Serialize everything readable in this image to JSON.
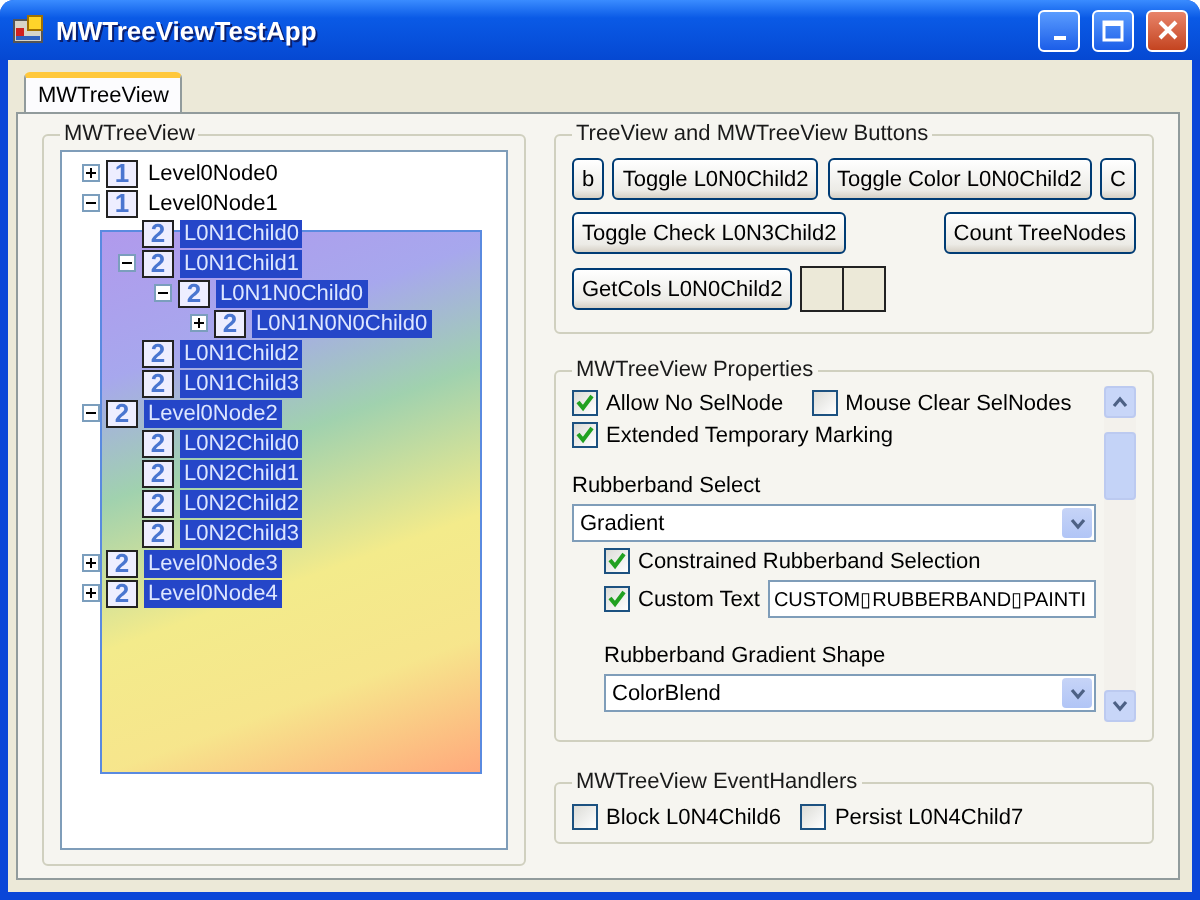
{
  "window": {
    "title": "MWTreeViewTestApp"
  },
  "tabs": [
    {
      "label": "MWTreeView",
      "selected": true
    }
  ],
  "tree_group": {
    "title": "MWTreeView",
    "nodes": [
      {
        "badge": "1",
        "label": "Level0Node0",
        "selected": false,
        "expanded": false
      },
      {
        "badge": "1",
        "label": "Level0Node1",
        "selected": false,
        "expanded": true,
        "children": [
          {
            "badge": "2",
            "label": "L0N1Child0",
            "selected": true
          },
          {
            "badge": "2",
            "label": "L0N1Child1",
            "selected": true,
            "expanded": true,
            "children": [
              {
                "badge": "2",
                "label": "L0N1N0Child0",
                "selected": true,
                "expanded": true,
                "children": [
                  {
                    "badge": "2",
                    "label": "L0N1N0N0Child0",
                    "selected": true,
                    "expanded": false
                  }
                ]
              }
            ]
          },
          {
            "badge": "2",
            "label": "L0N1Child2",
            "selected": true
          },
          {
            "badge": "2",
            "label": "L0N1Child3",
            "selected": true
          }
        ]
      },
      {
        "badge": "2",
        "label": "Level0Node2",
        "selected": true,
        "expanded": true,
        "children": [
          {
            "badge": "2",
            "label": "L0N2Child0",
            "selected": true
          },
          {
            "badge": "2",
            "label": "L0N2Child1",
            "selected": true
          },
          {
            "badge": "2",
            "label": "L0N2Child2",
            "selected": true
          },
          {
            "badge": "2",
            "label": "L0N2Child3",
            "selected": true
          }
        ]
      },
      {
        "badge": "2",
        "label": "Level0Node3",
        "selected": true,
        "expanded": false
      },
      {
        "badge": "2",
        "label": "Level0Node4",
        "selected": true,
        "expanded": false
      }
    ]
  },
  "buttons_group": {
    "title": "TreeView and MWTreeView Buttons",
    "buttons": [
      {
        "kind": "button",
        "label": "b"
      },
      {
        "kind": "button",
        "label": "Toggle L0N0Child2"
      },
      {
        "kind": "button",
        "label": "Toggle Color L0N0Child2"
      },
      {
        "kind": "button",
        "label": "C"
      },
      {
        "kind": "button",
        "label": "Toggle Check L0N3Child2"
      },
      {
        "kind": "button",
        "label": "Count TreeNodes"
      },
      {
        "kind": "button",
        "label": "GetCols L0N0Child2"
      },
      {
        "kind": "swatch"
      },
      {
        "kind": "swatch"
      }
    ]
  },
  "properties_group": {
    "title": "MWTreeView Properties",
    "items": [
      {
        "kind": "checkbox_row",
        "items": [
          {
            "label": "Allow No SelNode",
            "checked": true
          },
          {
            "label": "Mouse Clear SelNodes",
            "checked": false
          }
        ]
      },
      {
        "kind": "checkbox",
        "label": "Extended Temporary Marking",
        "checked": true
      },
      {
        "kind": "label",
        "label": "Rubberband Select"
      },
      {
        "kind": "select",
        "value": "Gradient"
      },
      {
        "kind": "subgroup",
        "items": [
          {
            "kind": "checkbox",
            "label": "Constrained Rubberband Selection",
            "checked": true
          },
          {
            "kind": "text_field",
            "label": "Custom Text",
            "checked": true,
            "value": "CUSTOM▯RUBBERBAND▯PAINTI"
          },
          {
            "kind": "label",
            "label": "Rubberband Gradient Shape"
          },
          {
            "kind": "select",
            "value": "ColorBlend"
          }
        ]
      }
    ]
  },
  "events_group": {
    "title": "MWTreeView EventHandlers",
    "items": [
      {
        "label": "Block L0N4Child6",
        "checked": false
      },
      {
        "label": "Persist L0N4Child7",
        "checked": false
      }
    ]
  }
}
